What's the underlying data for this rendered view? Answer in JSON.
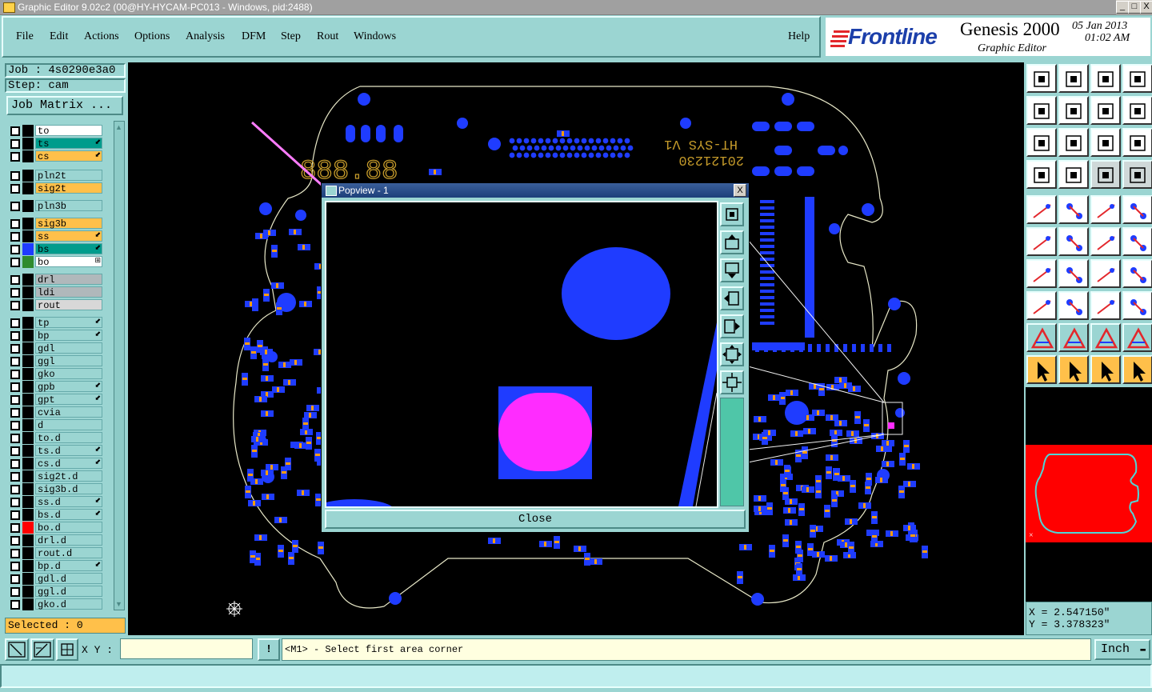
{
  "window": {
    "title": "Graphic Editor 9.02c2 (00@HY-HYCAM-PC013 - Windows, pid:2488)",
    "min": "_",
    "max": "□",
    "close": "X"
  },
  "menu": {
    "file": "File",
    "edit": "Edit",
    "actions": "Actions",
    "options": "Options",
    "analysis": "Analysis",
    "dfm": "DFM",
    "step": "Step",
    "rout": "Rout",
    "windows": "Windows",
    "help": "Help"
  },
  "brand": {
    "logo": "Frontline",
    "product": "Genesis 2000",
    "subtitle": "Graphic Editor",
    "date": "05 Jan 2013",
    "time": "01:02 AM"
  },
  "job": {
    "job_label": "Job : 4s0290e3a0",
    "step_label": "Step: cam",
    "matrix_button": "Job Matrix ..."
  },
  "layers": [
    {
      "name": "to",
      "color": "#ffffff",
      "swatch": "#000000",
      "arrow": ""
    },
    {
      "name": "ts",
      "color": "#009c8c",
      "swatch": "#000000",
      "arrow": "⬋"
    },
    {
      "name": "cs",
      "color": "#ffc04a",
      "swatch": "#000000",
      "arrow": "⬋"
    },
    {
      "name": "pln2t",
      "color": "#9bd5d2",
      "swatch": "#000000",
      "arrow": ""
    },
    {
      "name": "sig2t",
      "color": "#ffc04a",
      "swatch": "#000000",
      "arrow": ""
    },
    {
      "name": "pln3b",
      "color": "#9bd5d2",
      "swatch": "#000000",
      "arrow": ""
    },
    {
      "name": "sig3b",
      "color": "#ffc04a",
      "swatch": "#000000",
      "arrow": ""
    },
    {
      "name": "ss",
      "color": "#ffc04a",
      "swatch": "#000000",
      "arrow": "⬋"
    },
    {
      "name": "bs",
      "color": "#009c8c",
      "swatch": "#1f3cff",
      "arrow": "⬋"
    },
    {
      "name": "bo",
      "color": "#ffffff",
      "swatch": "#2e8b2e",
      "arrow": "⊞"
    },
    {
      "name": "drl",
      "color": "#b0b8bb",
      "swatch": "#000000",
      "arrow": ""
    },
    {
      "name": "ldi",
      "color": "#b0b8bb",
      "swatch": "#000000",
      "arrow": ""
    },
    {
      "name": "rout",
      "color": "#d8d8d8",
      "swatch": "#000000",
      "arrow": ""
    },
    {
      "name": "tp",
      "color": "#9bd5d2",
      "swatch": "#000000",
      "arrow": "⬋"
    },
    {
      "name": "bp",
      "color": "#9bd5d2",
      "swatch": "#000000",
      "arrow": "⬋"
    },
    {
      "name": "gdl",
      "color": "#9bd5d2",
      "swatch": "#000000",
      "arrow": ""
    },
    {
      "name": "ggl",
      "color": "#9bd5d2",
      "swatch": "#000000",
      "arrow": ""
    },
    {
      "name": "gko",
      "color": "#9bd5d2",
      "swatch": "#000000",
      "arrow": ""
    },
    {
      "name": "gpb",
      "color": "#9bd5d2",
      "swatch": "#000000",
      "arrow": "⬋"
    },
    {
      "name": "gpt",
      "color": "#9bd5d2",
      "swatch": "#000000",
      "arrow": "⬋"
    },
    {
      "name": "cvia",
      "color": "#9bd5d2",
      "swatch": "#000000",
      "arrow": ""
    },
    {
      "name": "d",
      "color": "#9bd5d2",
      "swatch": "#000000",
      "arrow": ""
    },
    {
      "name": "to.d",
      "color": "#9bd5d2",
      "swatch": "#000000",
      "arrow": ""
    },
    {
      "name": "ts.d",
      "color": "#9bd5d2",
      "swatch": "#000000",
      "arrow": "⬋"
    },
    {
      "name": "cs.d",
      "color": "#9bd5d2",
      "swatch": "#000000",
      "arrow": "⬋"
    },
    {
      "name": "sig2t.d",
      "color": "#9bd5d2",
      "swatch": "#000000",
      "arrow": ""
    },
    {
      "name": "sig3b.d",
      "color": "#9bd5d2",
      "swatch": "#000000",
      "arrow": ""
    },
    {
      "name": "ss.d",
      "color": "#9bd5d2",
      "swatch": "#000000",
      "arrow": "⬋"
    },
    {
      "name": "bs.d",
      "color": "#9bd5d2",
      "swatch": "#000000",
      "arrow": "⬋"
    },
    {
      "name": "bo.d",
      "color": "#9bd5d2",
      "swatch": "#ff0000",
      "arrow": ""
    },
    {
      "name": "drl.d",
      "color": "#9bd5d2",
      "swatch": "#000000",
      "arrow": ""
    },
    {
      "name": "rout.d",
      "color": "#9bd5d2",
      "swatch": "#000000",
      "arrow": ""
    },
    {
      "name": "bp.d",
      "color": "#9bd5d2",
      "swatch": "#000000",
      "arrow": "⬋"
    },
    {
      "name": "gdl.d",
      "color": "#9bd5d2",
      "swatch": "#000000",
      "arrow": ""
    },
    {
      "name": "ggl.d",
      "color": "#9bd5d2",
      "swatch": "#000000",
      "arrow": ""
    },
    {
      "name": "gko.d",
      "color": "#9bd5d2",
      "swatch": "#000000",
      "arrow": ""
    }
  ],
  "selected": "Selected : 0",
  "board": {
    "silk_text_1": "HT-SYS V1",
    "silk_text_2": "20121230"
  },
  "popview": {
    "title": "Popview - 1",
    "close_x": "X",
    "close_button": "Close"
  },
  "coords": {
    "x": "X = 2.547150\"",
    "y": "Y = 3.378323\""
  },
  "command": {
    "xy_label": "X Y :",
    "xy_value": "",
    "message": "<M1> - Select first area corner",
    "units": "Inch"
  },
  "colors": {
    "panel": "#9bd5d2",
    "pad_blue": "#1f3cff",
    "pad_orange": "#ff9c00",
    "highlight_magenta": "#ff2cff",
    "outline": "#e8e8e8"
  }
}
